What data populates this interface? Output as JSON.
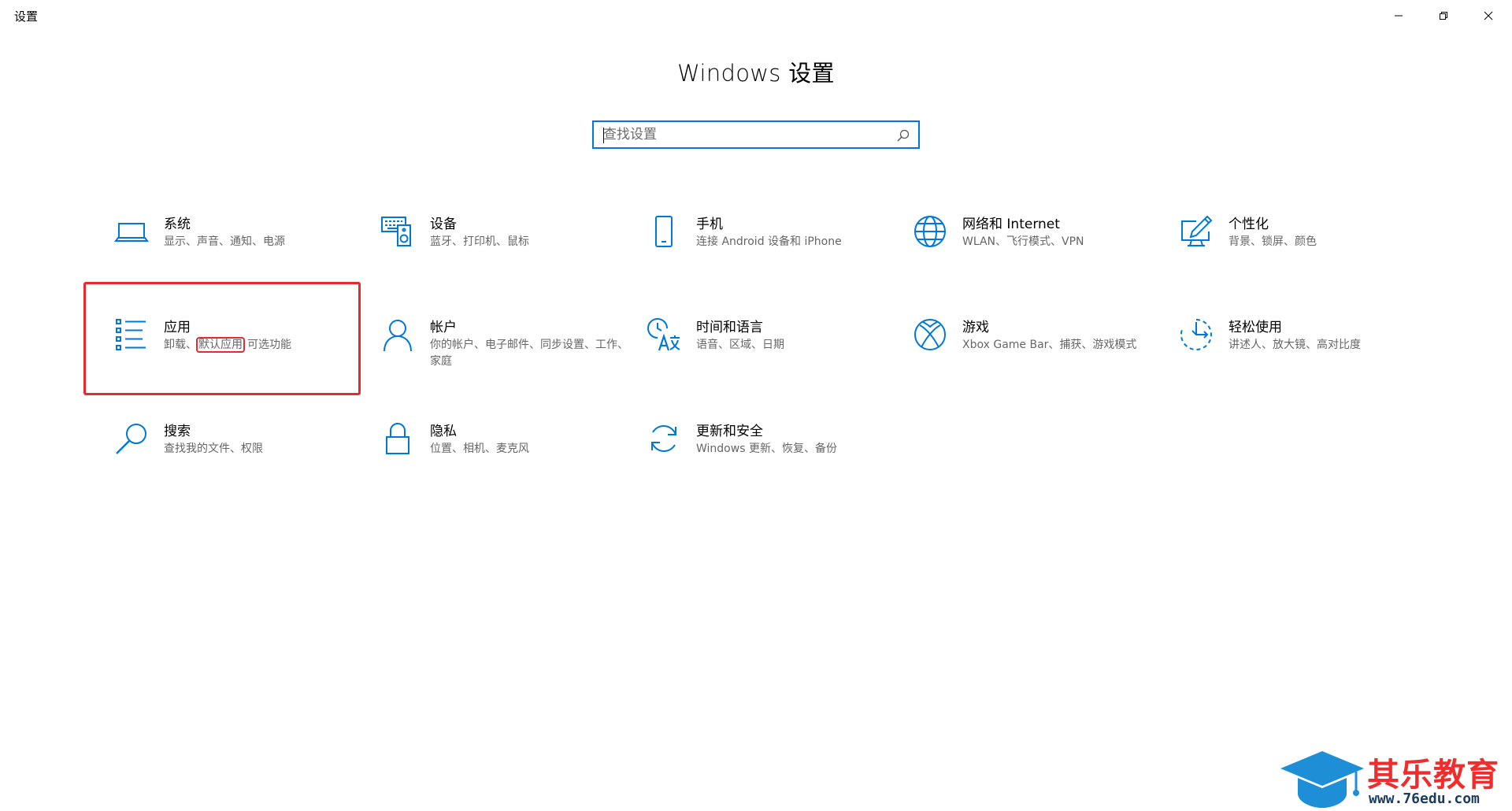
{
  "window": {
    "title": "设置",
    "controls": {
      "minimize_icon": "minimize-icon",
      "restore_icon": "restore-icon",
      "close_icon": "close-icon"
    }
  },
  "header": {
    "title": "Windows 设置",
    "search": {
      "placeholder": "查找设置",
      "value": ""
    }
  },
  "accent_color": "#0078d7",
  "highlight_color": "#e52b2b",
  "tiles": [
    {
      "id": "system",
      "title": "系统",
      "desc": "显示、声音、通知、电源",
      "icon": "laptop-icon"
    },
    {
      "id": "devices",
      "title": "设备",
      "desc": "蓝牙、打印机、鼠标",
      "icon": "keyboard-speaker-icon"
    },
    {
      "id": "phone",
      "title": "手机",
      "desc": "连接 Android 设备和 iPhone",
      "icon": "phone-icon"
    },
    {
      "id": "network",
      "title": "网络和 Internet",
      "desc": "WLAN、飞行模式、VPN",
      "icon": "globe-icon"
    },
    {
      "id": "personalization",
      "title": "个性化",
      "desc": "背景、锁屏、颜色",
      "icon": "pen-monitor-icon"
    },
    {
      "id": "apps",
      "title": "应用",
      "desc_parts": [
        "卸载、",
        "默认应用",
        "可选功能"
      ],
      "icon": "app-list-icon"
    },
    {
      "id": "accounts",
      "title": "帐户",
      "desc": "你的帐户、电子邮件、同步设置、工作、家庭",
      "icon": "person-icon"
    },
    {
      "id": "time",
      "title": "时间和语言",
      "desc": "语音、区域、日期",
      "icon": "time-language-icon"
    },
    {
      "id": "gaming",
      "title": "游戏",
      "desc": "Xbox Game Bar、捕获、游戏模式",
      "icon": "xbox-icon"
    },
    {
      "id": "ease",
      "title": "轻松使用",
      "desc": "讲述人、放大镜、高对比度",
      "icon": "ease-of-access-icon"
    },
    {
      "id": "search",
      "title": "搜索",
      "desc": "查找我的文件、权限",
      "icon": "magnifier-icon"
    },
    {
      "id": "privacy",
      "title": "隐私",
      "desc": "位置、相机、麦克风",
      "icon": "lock-icon"
    },
    {
      "id": "update",
      "title": "更新和安全",
      "desc": "Windows 更新、恢复、备份",
      "icon": "sync-arrows-icon"
    }
  ],
  "watermark": {
    "name": "其乐教育",
    "url": "www.76edu.com",
    "icon": "graduation-cap-icon"
  }
}
